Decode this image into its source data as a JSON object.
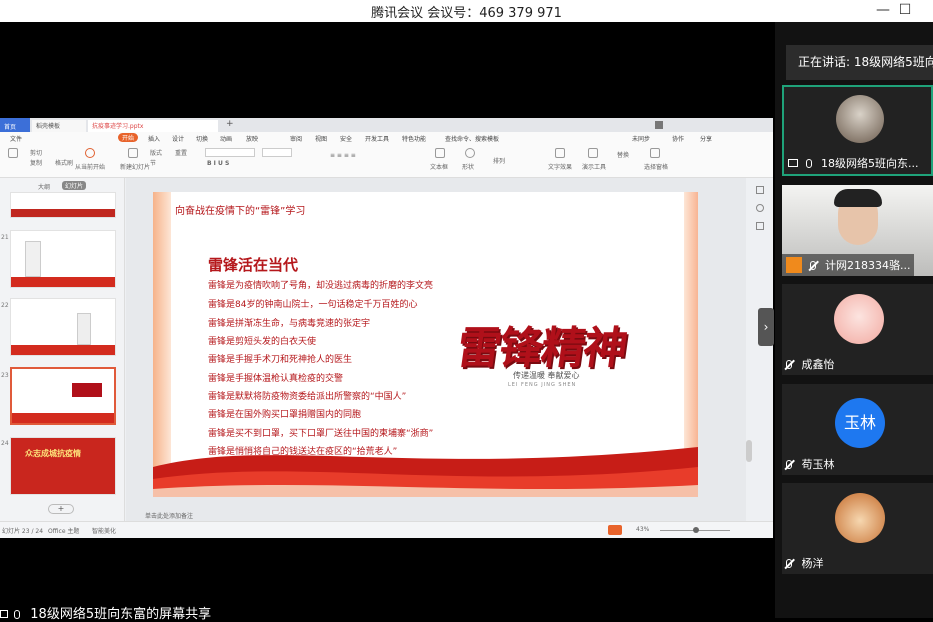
{
  "titlebar": {
    "title": "腾讯会议 会议号：469 379 971",
    "minimize": "—",
    "maximize": "☐"
  },
  "share_caption": "18级网络5班向东富的屏幕共享",
  "wps": {
    "tabs": [
      "首页",
      "稻壳模板",
      "抗疫事迹学习.pptx"
    ],
    "menus": [
      "文件",
      "开始",
      "插入",
      "设计",
      "切换",
      "动画",
      "放映",
      "审阅",
      "视图",
      "安全",
      "开发工具",
      "特色功能",
      "查找命令、搜索模板",
      "未同步",
      "协作",
      "分享"
    ],
    "ribbon_labels": [
      "剪切",
      "复制",
      "格式刷",
      "从当前开始",
      "新建幻灯片",
      "版式",
      "节",
      "重置",
      "文本框",
      "形状",
      "排列",
      "文字效果",
      "演示工具",
      "替换",
      "选择窗格"
    ],
    "status": {
      "slide_info": "幻灯片 23 / 24",
      "theme": "Office 主题",
      "note_hint": "单击此处添加备注",
      "smart_beautify": "智能美化",
      "zoom": "43%"
    },
    "thumbs_header": [
      "大纲",
      "幻灯片"
    ],
    "thumb_numbers": [
      "21",
      "22",
      "23",
      "24"
    ],
    "thumb_24_title": "众志成城抗疫情",
    "slide": {
      "header": "向奋战在疫情下的“雷锋”学习",
      "subtitle": "雷锋活在当代",
      "lines": [
        "雷锋是为疫情吹响了号角，却没逃过病毒的折磨的李文亮",
        "雷锋是84岁的钟南山院士，一句话稳定千万百姓的心",
        "雷锋是拼渐冻生命，与病毒竞速的张定宇",
        "雷锋是剪短头发的白衣天使",
        "雷锋是手握手术刀和死神抢人的医生",
        "雷锋是手握体温枪认真检疫的交警",
        "雷锋是默默将防疫物资委给派出所警察的“中国人”",
        "雷锋是在国外购买口罩捐赠国内的同胞",
        "雷锋是买不到口罩，买下口罩厂送往中国的柬埔寨“浙商”",
        "雷锋是悄悄将自己的钱送达在疫区的“拾荒老人”"
      ],
      "art_title": "雷锋精神",
      "art_sub": "传递温暖 奉献爱心",
      "art_pinyin": "LEI FENG JING SHEN"
    }
  },
  "panel": {
    "speaking": "正在讲话: 18级网络5班向东富",
    "participants": [
      {
        "name": "18级网络5班向东...",
        "muted": false
      },
      {
        "name": "计网218334骆...",
        "muted": true
      },
      {
        "name": "成鑫怡",
        "muted": true
      },
      {
        "name": "苟玉林",
        "muted": true,
        "initials": "玉林"
      },
      {
        "name": "杨洋",
        "muted": true
      }
    ],
    "colors": {
      "accent": "#1fa37a",
      "avatar_blue": "#1e78f0"
    }
  }
}
